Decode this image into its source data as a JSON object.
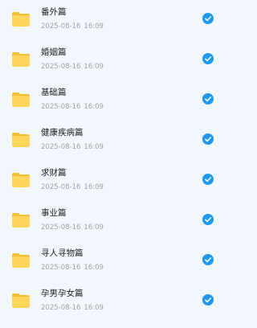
{
  "colors": {
    "background": "#f2f7fd",
    "folder": "#ffd65a",
    "folder_tab": "#f6bf2f",
    "check": "#1b9af5",
    "title": "#222222",
    "meta": "#a3a3a3"
  },
  "icons": {
    "folder": "folder-icon",
    "checked": "checkmark-circle-icon"
  },
  "items": [
    {
      "title": "番外篇",
      "date": "2025-08-16",
      "time": "16:09",
      "checked": true
    },
    {
      "title": "婚姻篇",
      "date": "2025-08-16",
      "time": "16:09",
      "checked": true
    },
    {
      "title": "基础篇",
      "date": "2025-08-16",
      "time": "16:09",
      "checked": true
    },
    {
      "title": "健康疾病篇",
      "date": "2025-08-16",
      "time": "16:09",
      "checked": true
    },
    {
      "title": "求财篇",
      "date": "2025-08-16",
      "time": "16:09",
      "checked": true
    },
    {
      "title": "事业篇",
      "date": "2025-08-16",
      "time": "16:09",
      "checked": true
    },
    {
      "title": "寻人寻物篇",
      "date": "2025-08-16",
      "time": "16:09",
      "checked": true
    },
    {
      "title": "孕男孕女篇",
      "date": "2025-08-16",
      "time": "16:09",
      "checked": true
    }
  ]
}
